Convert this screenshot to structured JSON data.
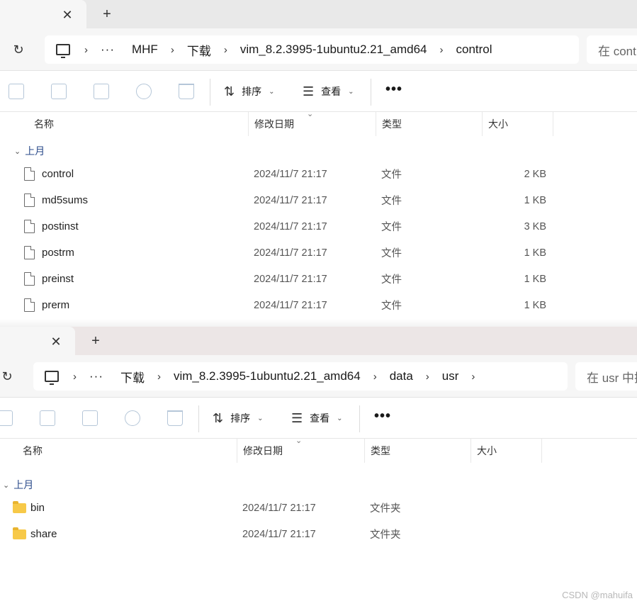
{
  "window1": {
    "breadcrumbs": [
      "MHF",
      "下载",
      "vim_8.2.3995-1ubuntu2.21_amd64",
      "control"
    ],
    "more_label": "···",
    "search_placeholder": "在 control 中搜索",
    "toolbar": {
      "sort_label": "排序",
      "view_label": "查看",
      "more_label": "•••"
    },
    "columns": {
      "name": "名称",
      "modified": "修改日期",
      "type": "类型",
      "size": "大小"
    },
    "group_label": "上月",
    "rows": [
      {
        "name": "control",
        "modified": "2024/11/7 21:17",
        "type": "文件",
        "size": "2 KB"
      },
      {
        "name": "md5sums",
        "modified": "2024/11/7 21:17",
        "type": "文件",
        "size": "1 KB"
      },
      {
        "name": "postinst",
        "modified": "2024/11/7 21:17",
        "type": "文件",
        "size": "3 KB"
      },
      {
        "name": "postrm",
        "modified": "2024/11/7 21:17",
        "type": "文件",
        "size": "1 KB"
      },
      {
        "name": "preinst",
        "modified": "2024/11/7 21:17",
        "type": "文件",
        "size": "1 KB"
      },
      {
        "name": "prerm",
        "modified": "2024/11/7 21:17",
        "type": "文件",
        "size": "1 KB"
      }
    ]
  },
  "window2": {
    "breadcrumbs": [
      "下载",
      "vim_8.2.3995-1ubuntu2.21_amd64",
      "data",
      "usr"
    ],
    "more_label": "···",
    "search_placeholder": "在 usr 中搜索",
    "toolbar": {
      "sort_label": "排序",
      "view_label": "查看",
      "more_label": "•••"
    },
    "columns": {
      "name": "名称",
      "modified": "修改日期",
      "type": "类型",
      "size": "大小"
    },
    "group_label": "上月",
    "rows": [
      {
        "name": "bin",
        "modified": "2024/11/7 21:17",
        "type": "文件夹",
        "size": ""
      },
      {
        "name": "share",
        "modified": "2024/11/7 21:17",
        "type": "文件夹",
        "size": ""
      }
    ]
  },
  "icons": {
    "close": "✕",
    "new_tab": "+",
    "refresh": "↻",
    "chevron": "›",
    "sort": "⇅",
    "view": "☰",
    "caret": "⌄",
    "group_chevron": "⌄",
    "sort_caret": "⌄"
  },
  "colors": {
    "folder": "#f7c948",
    "group_text": "#2a4a8a",
    "tab_bar": "#e9e9e9"
  },
  "watermark": "CSDN @mahuifa"
}
